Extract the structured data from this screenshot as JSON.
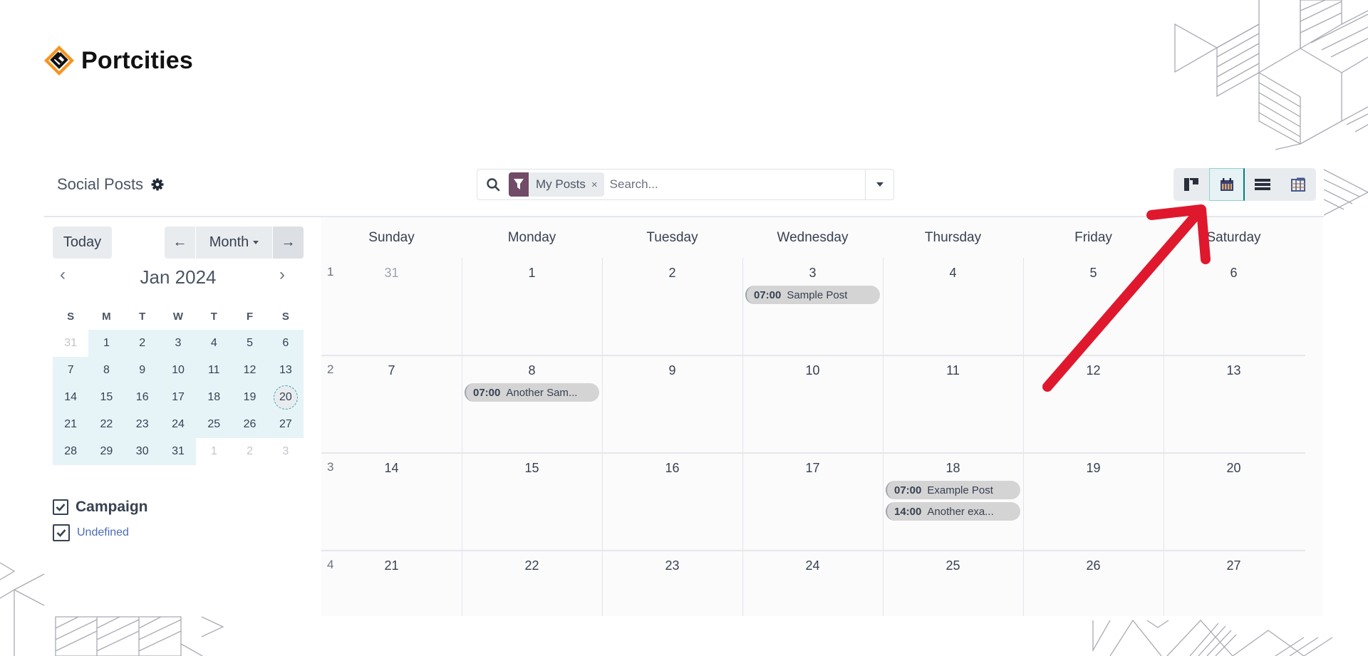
{
  "brand": {
    "name": "Portcities",
    "logo_icon": "diamond-logo-icon",
    "accent": "#f7941d"
  },
  "control_panel": {
    "title": "Social Posts",
    "settings_icon": "gear-icon",
    "search": {
      "facet_icon": "filter-icon",
      "facet_label": "My Posts",
      "facet_close": "×",
      "placeholder": "Search...",
      "value": "",
      "facet_color": "#714b67"
    },
    "views": [
      {
        "name": "kanban",
        "icon": "kanban-icon",
        "active": false
      },
      {
        "name": "calendar",
        "icon": "calendar-icon",
        "active": true
      },
      {
        "name": "list",
        "icon": "list-icon",
        "active": false
      },
      {
        "name": "pivot",
        "icon": "pivot-table-icon",
        "active": false
      }
    ]
  },
  "sidebar": {
    "today_label": "Today",
    "prev_label": "←",
    "next_label": "→",
    "scale_label": "Month",
    "mini_calendar": {
      "title": "Jan 2024",
      "prev": "‹",
      "next": "›",
      "weekdays": [
        "S",
        "M",
        "T",
        "W",
        "T",
        "F",
        "S"
      ],
      "weeks": [
        [
          "31",
          "1",
          "2",
          "3",
          "4",
          "5",
          "6"
        ],
        [
          "7",
          "8",
          "9",
          "10",
          "11",
          "12",
          "13"
        ],
        [
          "14",
          "15",
          "16",
          "17",
          "18",
          "19",
          "20"
        ],
        [
          "21",
          "22",
          "23",
          "24",
          "25",
          "26",
          "27"
        ],
        [
          "28",
          "29",
          "30",
          "31",
          "1",
          "2",
          "3"
        ]
      ],
      "today": "20"
    },
    "filters": {
      "title": "Campaign",
      "checked": true,
      "items": [
        {
          "label": "Undefined",
          "checked": true
        }
      ]
    }
  },
  "calendar": {
    "day_names": [
      "Sunday",
      "Monday",
      "Tuesday",
      "Wednesday",
      "Thursday",
      "Friday",
      "Saturday"
    ],
    "weeks": [
      {
        "number": "1",
        "days": [
          "31",
          "1",
          "2",
          "3",
          "4",
          "5",
          "6"
        ]
      },
      {
        "number": "2",
        "days": [
          "7",
          "8",
          "9",
          "10",
          "11",
          "12",
          "13"
        ]
      },
      {
        "number": "3",
        "days": [
          "14",
          "15",
          "16",
          "17",
          "18",
          "19",
          "20"
        ]
      },
      {
        "number": "4",
        "days": [
          "21",
          "22",
          "23",
          "24",
          "25",
          "26",
          "27"
        ]
      }
    ],
    "events": [
      {
        "week": 0,
        "day": 3,
        "slot": 0,
        "time": "07:00",
        "title": "Sample Post"
      },
      {
        "week": 1,
        "day": 1,
        "slot": 0,
        "time": "07:00",
        "title": "Another Sam..."
      },
      {
        "week": 2,
        "day": 4,
        "slot": 0,
        "time": "07:00",
        "title": "Example Post"
      },
      {
        "week": 2,
        "day": 4,
        "slot": 1,
        "time": "14:00",
        "title": "Another exa..."
      }
    ]
  },
  "annotation": {
    "type": "arrow",
    "color": "#e0182d",
    "points_to": "calendar-view-button"
  }
}
